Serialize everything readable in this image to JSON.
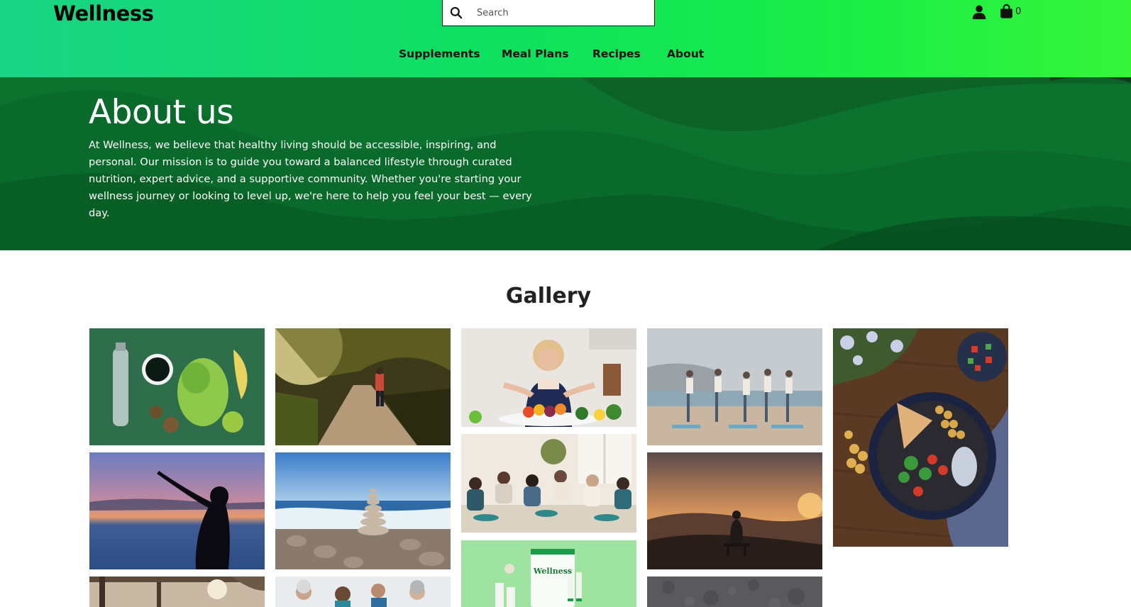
{
  "header": {
    "brand": "Wellness",
    "search_placeholder": "Search",
    "cart_count": "0",
    "icons": {
      "search": "search-icon",
      "user": "user-icon",
      "cart": "shopping-bag-icon"
    }
  },
  "nav": {
    "items": [
      {
        "label": "Supplements"
      },
      {
        "label": "Meal Plans"
      },
      {
        "label": "Recipes"
      },
      {
        "label": "About"
      }
    ]
  },
  "hero": {
    "title": "About us",
    "text": "At Wellness, we believe that healthy living should be accessible, inspiring, and personal. Our mission is to guide you toward a balanced lifestyle through curated nutrition, expert advice, and a supportive community. Whether you're starting your wellness journey or looking to level up, we're here to help you feel your best — every day."
  },
  "gallery": {
    "title": "Gallery",
    "package_text": "Wellness"
  },
  "colors": {
    "header_gradient_start": "#19d486",
    "header_gradient_end": "#35f43a",
    "hero_background": "#0b6a2c",
    "text_dark": "#111111",
    "text_light": "#ffffff"
  }
}
